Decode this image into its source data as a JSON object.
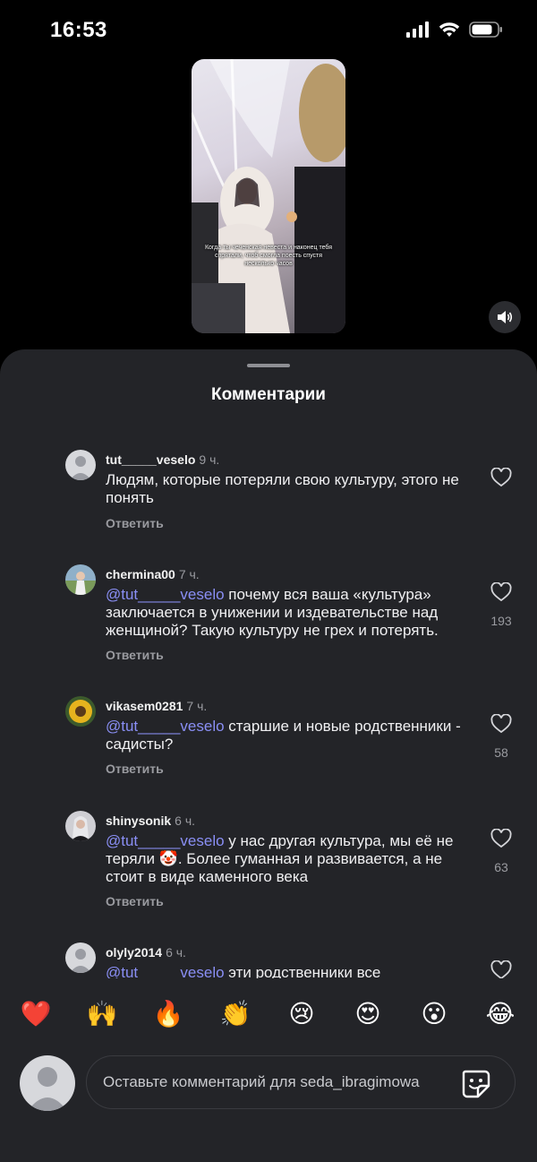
{
  "status_bar": {
    "time": "16:53"
  },
  "video": {
    "caption": "Когда ты чеченская невеста и наконец тебя спрятали, чтоб смогла поесть спустя несколько часов"
  },
  "sheet": {
    "title": "Комментарии"
  },
  "comments": [
    {
      "user": "tut_____veselo",
      "time": "9 ч.",
      "mention": "",
      "text": "Людям, которые потеряли свою культуру, этого не понять",
      "reply": "Ответить",
      "likes": ""
    },
    {
      "user": "chermina00",
      "time": "7 ч.",
      "mention": "@tut_____veselo",
      "text": " почему вся ваша «культура» заключается в унижении и издевательстве над женщиной? Такую культуру не грех и потерять.",
      "reply": "Ответить",
      "likes": "193"
    },
    {
      "user": "vikasem0281",
      "time": "7 ч.",
      "mention": "@tut_____veselo",
      "text": " старшие и новые родственники - садисты?",
      "reply": "Ответить",
      "likes": "58"
    },
    {
      "user": "shinysonik",
      "time": "6 ч.",
      "mention": "@tut_____veselo",
      "text": " у нас другая культура, мы её не теряли 🤡. Более гуманная и развивается, а не стоит в виде каменного века",
      "reply": "Ответить",
      "likes": "63"
    },
    {
      "user": "olyly2014",
      "time": "6 ч.",
      "mention": "@tut_____veselo",
      "text": " эти родственники все",
      "reply": "",
      "likes": ""
    }
  ],
  "emoji_bar": [
    "❤️",
    "🙌",
    "🔥",
    "👏",
    "😢",
    "😍",
    "😮",
    "😂"
  ],
  "composer": {
    "placeholder": "Оставьте комментарий для seda_ibragimowa"
  },
  "colors": {
    "sheet_bg": "#232428",
    "mention": "#8a8ff5",
    "secondary_text": "#9a9ba0"
  }
}
